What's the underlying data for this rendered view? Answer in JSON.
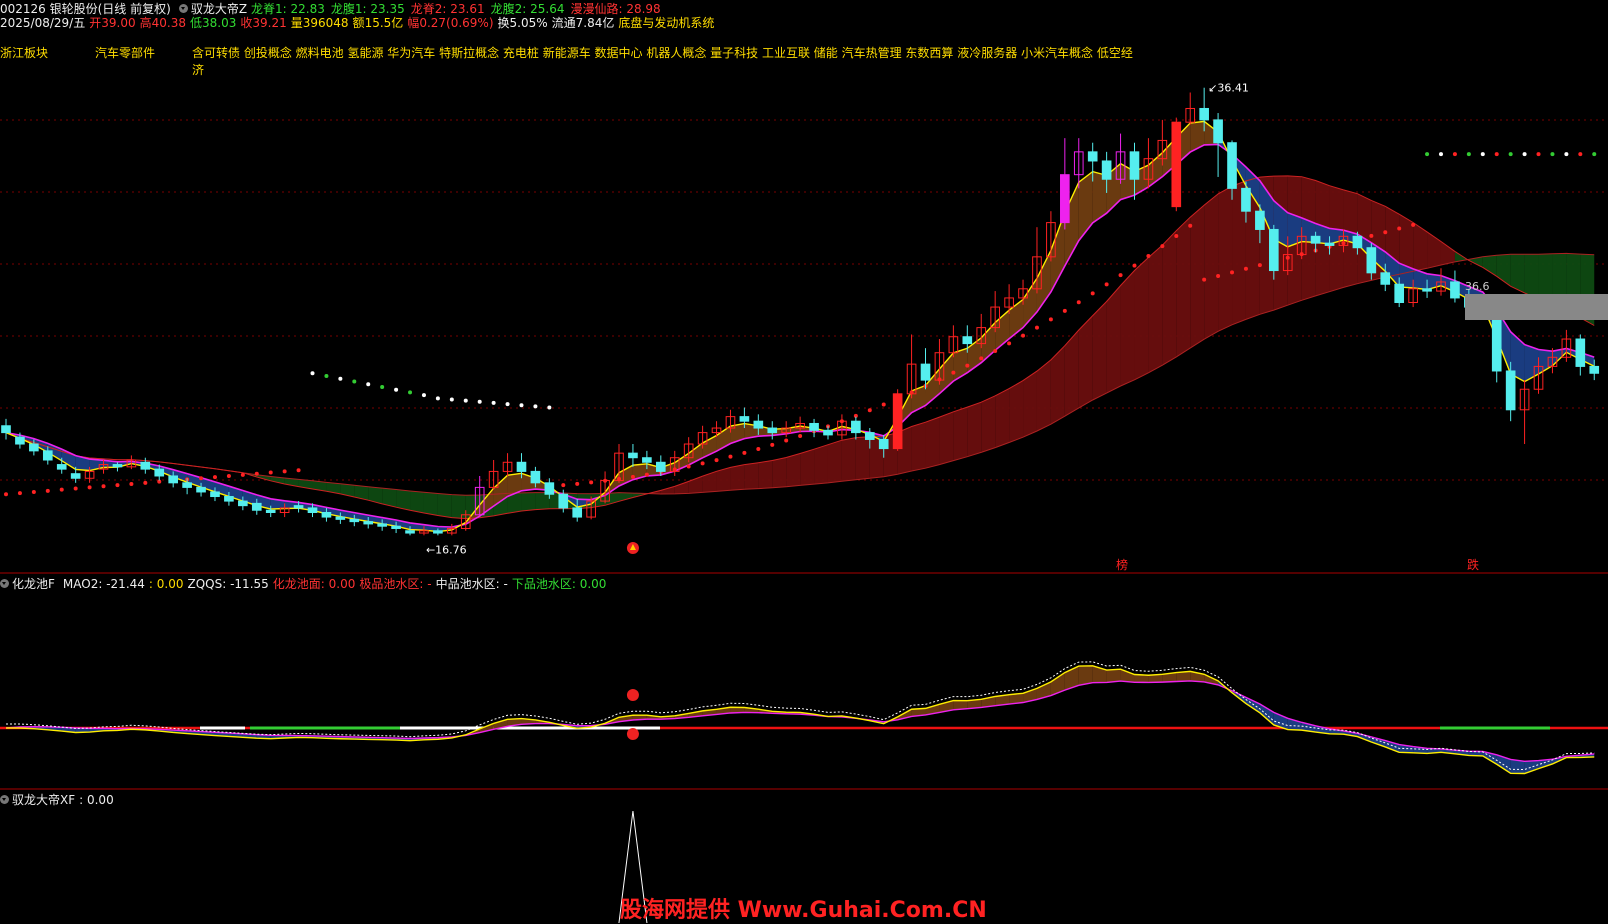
{
  "header": {
    "stock": "002126 银轮股份(日线 前复权)",
    "main_indicator": "驭龙大帝Z",
    "params": [
      {
        "label": "龙脊1:",
        "value": "22.83",
        "color": "#33dd33"
      },
      {
        "label": "龙腹1:",
        "value": "23.35",
        "color": "#33dd33"
      },
      {
        "label": "龙脊2:",
        "value": "23.61",
        "color": "#ff3333"
      },
      {
        "label": "龙腹2:",
        "value": "25.64",
        "color": "#33dd33"
      },
      {
        "label": "漫漫仙路:",
        "value": "28.98",
        "color": "#ff3333"
      }
    ]
  },
  "quote": {
    "date": "2025/08/29/五",
    "open_label": "开",
    "open": "39.00",
    "high_label": "高",
    "high": "40.38",
    "low_label": "低",
    "low": "38.03",
    "close_label": "收",
    "close": "39.21",
    "vol_label": "量",
    "vol": "396048",
    "amount_label": "额",
    "amount": "15.5亿",
    "change_label": "幅",
    "change": "0.27(0.69%)",
    "turnover_label": "换",
    "turnover": "5.05%",
    "float_label": "流通",
    "float": "7.84亿",
    "concept": "底盘与发动机系统"
  },
  "sectors": {
    "region": "浙江板块",
    "industry": "汽车零部件",
    "concepts": "含可转债 创投概念 燃料电池 氢能源 华为汽车 特斯拉概念 充电桩 新能源车 数据中心 机器人概念 量子科技 工业互联 储能 汽车热管理 东数西算 液冷服务器 小米汽车概念 低空经济"
  },
  "annotations": {
    "high_mark": "36.41",
    "low_mark": "16.76",
    "right_mark": "36.6",
    "list_badge": "榜",
    "fall_badge": "跌"
  },
  "panel2": {
    "name": "化龙池F",
    "mao2_label": "MAO2:",
    "mao2": "-21.44",
    "v2": ": 0.00",
    "zqqs_label": "ZQQS:",
    "zqqs": "-11.55",
    "hlcm_label": "化龙池面:",
    "hlcm": "0.00",
    "jp_label": "极品池水区:",
    "jp": "-",
    "zp_label": "中品池水区:",
    "zp": "-",
    "xp_label": "下品池水区:",
    "xp": "0.00"
  },
  "panel3": {
    "name": "驭龙大帝XF",
    "value": ": 0.00"
  },
  "watermark": "股海网提供 Www.Guhai.Com.CN",
  "colors": {
    "up": "#ff2222",
    "down": "#55eeee",
    "magenta": "#ee22ee",
    "yellow_line": "#ffee00",
    "green_line": "#33cc33",
    "sar_red": "#ff2222",
    "sar_white": "#ffffff",
    "sar_green": "#33cc33",
    "grid": "#7a0000"
  },
  "chart_data": {
    "type": "candlestick",
    "candles": [
      [
        21.6,
        21.3,
        21.9,
        21.0
      ],
      [
        21.1,
        20.8,
        21.3,
        20.6
      ],
      [
        20.8,
        20.5,
        21.0,
        20.3
      ],
      [
        20.5,
        20.1,
        20.7,
        19.9
      ],
      [
        19.9,
        19.7,
        20.2,
        19.5
      ],
      [
        19.5,
        19.3,
        19.8,
        19.1
      ],
      [
        19.3,
        19.6,
        19.8,
        19.1
      ],
      [
        19.7,
        19.9,
        20.1,
        19.5
      ],
      [
        19.9,
        19.8,
        20.0,
        19.6
      ],
      [
        19.8,
        20.1,
        20.3,
        19.7
      ],
      [
        20.0,
        19.7,
        20.2,
        19.5
      ],
      [
        19.7,
        19.4,
        19.9,
        19.2
      ],
      [
        19.4,
        19.1,
        19.6,
        18.9
      ],
      [
        19.1,
        18.9,
        19.3,
        18.6
      ],
      [
        18.9,
        18.7,
        19.1,
        18.5
      ],
      [
        18.7,
        18.5,
        18.9,
        18.3
      ],
      [
        18.5,
        18.3,
        18.7,
        18.1
      ],
      [
        18.3,
        18.1,
        18.5,
        17.9
      ],
      [
        18.2,
        17.9,
        18.4,
        17.7
      ],
      [
        17.9,
        17.8,
        18.1,
        17.6
      ],
      [
        17.8,
        18.0,
        18.2,
        17.6
      ],
      [
        18.1,
        18.0,
        18.3,
        17.8
      ],
      [
        18.0,
        17.8,
        18.2,
        17.6
      ],
      [
        17.8,
        17.6,
        18.0,
        17.4
      ],
      [
        17.6,
        17.5,
        17.8,
        17.3
      ],
      [
        17.5,
        17.4,
        17.7,
        17.2
      ],
      [
        17.4,
        17.3,
        17.6,
        17.1
      ],
      [
        17.3,
        17.2,
        17.5,
        17.0
      ],
      [
        17.2,
        17.1,
        17.4,
        16.9
      ],
      [
        17.0,
        16.9,
        17.2,
        16.8
      ],
      [
        16.9,
        17.0,
        17.2,
        16.8
      ],
      [
        17.0,
        16.9,
        17.1,
        16.8
      ],
      [
        16.9,
        17.1,
        17.3,
        16.8
      ],
      [
        17.1,
        17.7,
        17.9,
        17.0
      ],
      [
        17.7,
        18.9,
        19.4,
        17.6
      ],
      [
        18.9,
        19.6,
        20.1,
        18.8
      ],
      [
        19.6,
        20.0,
        20.4,
        19.4
      ],
      [
        20.0,
        19.6,
        20.4,
        19.3
      ],
      [
        19.6,
        19.1,
        19.8,
        18.9
      ],
      [
        19.1,
        18.6,
        19.3,
        18.4
      ],
      [
        18.6,
        18.0,
        18.8,
        17.8
      ],
      [
        18.0,
        17.6,
        18.4,
        17.4
      ],
      [
        17.6,
        18.3,
        18.5,
        17.5
      ],
      [
        18.3,
        19.2,
        19.6,
        18.2
      ],
      [
        19.2,
        20.4,
        20.8,
        19.1
      ],
      [
        20.4,
        20.2,
        20.8,
        19.8
      ],
      [
        20.2,
        20.0,
        20.5,
        19.7
      ],
      [
        20.0,
        19.6,
        20.3,
        19.4
      ],
      [
        19.6,
        20.2,
        20.5,
        19.4
      ],
      [
        20.2,
        20.8,
        21.1,
        20.0
      ],
      [
        20.8,
        21.3,
        21.6,
        20.6
      ],
      [
        21.3,
        21.5,
        21.8,
        21.1
      ],
      [
        21.5,
        22.0,
        22.3,
        21.3
      ],
      [
        22.0,
        21.8,
        22.4,
        21.5
      ],
      [
        21.8,
        21.5,
        22.1,
        21.2
      ],
      [
        21.5,
        21.3,
        21.8,
        21.0
      ],
      [
        21.3,
        21.5,
        21.8,
        21.1
      ],
      [
        21.5,
        21.7,
        22.0,
        21.3
      ],
      [
        21.7,
        21.4,
        21.9,
        21.1
      ],
      [
        21.4,
        21.2,
        21.6,
        21.0
      ],
      [
        21.2,
        21.8,
        22.1,
        21.0
      ],
      [
        21.8,
        21.3,
        22.0,
        21.0
      ],
      [
        21.3,
        21.0,
        21.5,
        20.6
      ],
      [
        21.0,
        20.6,
        21.2,
        20.2
      ],
      [
        20.6,
        23.0,
        23.2,
        20.5
      ],
      [
        23.0,
        24.3,
        25.6,
        22.8
      ],
      [
        24.3,
        23.6,
        25.0,
        23.2
      ],
      [
        23.6,
        24.8,
        25.4,
        23.4
      ],
      [
        24.8,
        25.5,
        26.0,
        24.6
      ],
      [
        25.5,
        25.2,
        26.0,
        24.8
      ],
      [
        25.2,
        25.9,
        26.5,
        25.0
      ],
      [
        25.9,
        26.8,
        27.5,
        25.7
      ],
      [
        26.8,
        27.2,
        27.8,
        26.5
      ],
      [
        27.2,
        27.6,
        28.0,
        26.9
      ],
      [
        27.6,
        29.0,
        30.3,
        27.4
      ],
      [
        29.0,
        30.5,
        31.0,
        28.8
      ],
      [
        30.5,
        32.6,
        34.2,
        30.2
      ],
      [
        32.6,
        33.6,
        34.2,
        32.0
      ],
      [
        33.6,
        33.2,
        34.0,
        32.3
      ],
      [
        33.2,
        32.4,
        33.6,
        31.8
      ],
      [
        32.4,
        33.6,
        34.4,
        32.2
      ],
      [
        33.6,
        32.4,
        34.0,
        31.5
      ],
      [
        32.4,
        33.3,
        34.2,
        32.0
      ],
      [
        33.3,
        34.1,
        35.0,
        33.0
      ],
      [
        31.2,
        34.9,
        35.1,
        31.0
      ],
      [
        34.9,
        35.5,
        36.2,
        34.8
      ],
      [
        35.5,
        35.0,
        36.41,
        34.5
      ],
      [
        35.0,
        34.0,
        35.3,
        32.5
      ],
      [
        34.0,
        32.0,
        34.1,
        31.5
      ],
      [
        32.0,
        31.0,
        32.3,
        30.5
      ],
      [
        31.0,
        30.2,
        31.3,
        29.6
      ],
      [
        30.2,
        28.4,
        30.4,
        28.0
      ],
      [
        28.4,
        29.1,
        29.9,
        28.2
      ],
      [
        29.1,
        29.9,
        30.3,
        28.9
      ],
      [
        29.9,
        29.6,
        30.1,
        29.2
      ],
      [
        29.6,
        29.5,
        29.9,
        29.1
      ],
      [
        29.5,
        29.9,
        30.2,
        29.2
      ],
      [
        29.9,
        29.4,
        30.1,
        29.1
      ],
      [
        29.4,
        28.3,
        29.6,
        28.0
      ],
      [
        28.3,
        27.8,
        28.7,
        27.5
      ],
      [
        27.8,
        27.0,
        28.1,
        26.8
      ],
      [
        27.0,
        27.6,
        28.0,
        26.8
      ],
      [
        27.6,
        27.5,
        28.0,
        27.2
      ],
      [
        27.5,
        27.9,
        28.5,
        27.3
      ],
      [
        27.9,
        27.2,
        28.4,
        27.0
      ],
      [
        27.2,
        26.8,
        27.6,
        26.5
      ],
      [
        26.8,
        26.6,
        27.0,
        26.3
      ],
      [
        26.6,
        24.0,
        26.8,
        23.5
      ],
      [
        24.0,
        22.3,
        24.4,
        21.8
      ],
      [
        22.3,
        23.2,
        23.6,
        20.8
      ],
      [
        23.2,
        24.2,
        24.6,
        23.0
      ],
      [
        24.2,
        24.6,
        25.0,
        23.9
      ],
      [
        24.6,
        25.4,
        25.8,
        24.4
      ],
      [
        25.4,
        24.2,
        25.6,
        23.8
      ],
      [
        24.2,
        23.9,
        24.5,
        23.6
      ]
    ],
    "ylim": [
      15.5,
      38.5
    ]
  }
}
